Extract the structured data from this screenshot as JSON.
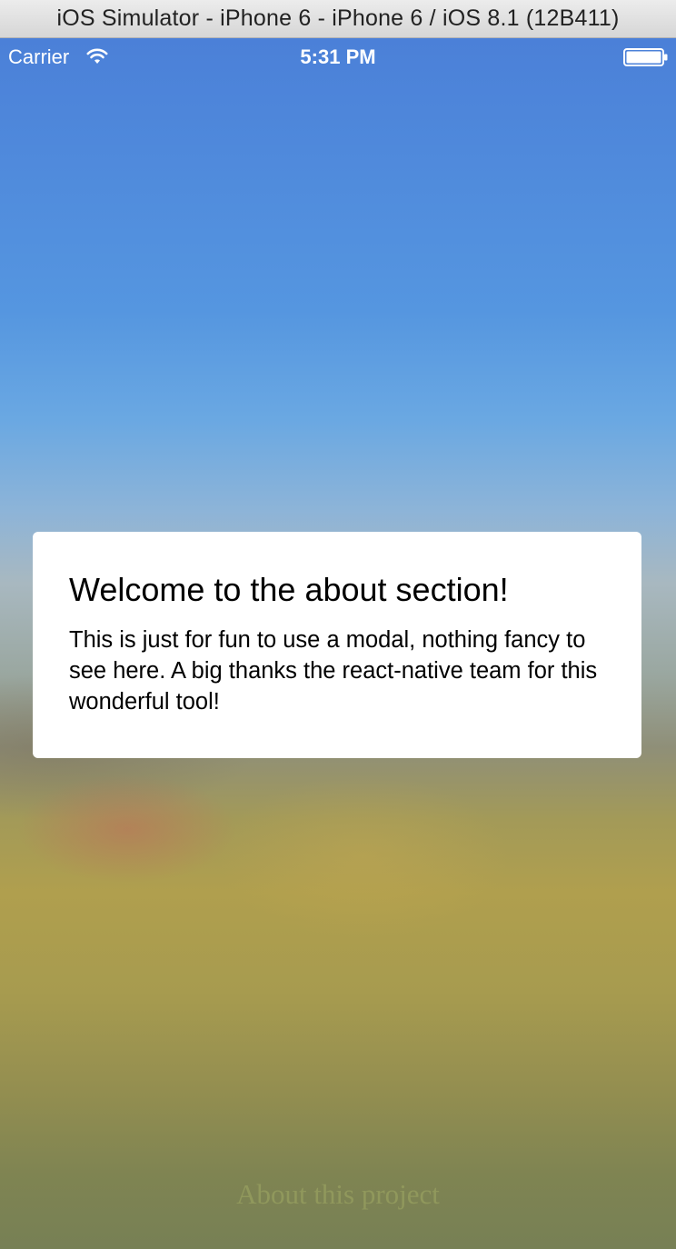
{
  "window": {
    "title": "iOS Simulator - iPhone 6 - iPhone 6 / iOS 8.1 (12B411)"
  },
  "status_bar": {
    "carrier": "Carrier",
    "wifi_icon": "wifi-icon",
    "time": "5:31 PM",
    "battery_icon": "battery-icon",
    "text_color": "#ffffff"
  },
  "modal": {
    "title": "Welcome to the about section!",
    "body": "This is just for fun to use a modal, nothing fancy to see here. A big thanks the react-native team for this wonderful tool!",
    "background": "#ffffff"
  },
  "footer": {
    "link_label": "About this project"
  },
  "colors": {
    "sky_top": "#4b80d8",
    "field": "#b09f4e"
  }
}
